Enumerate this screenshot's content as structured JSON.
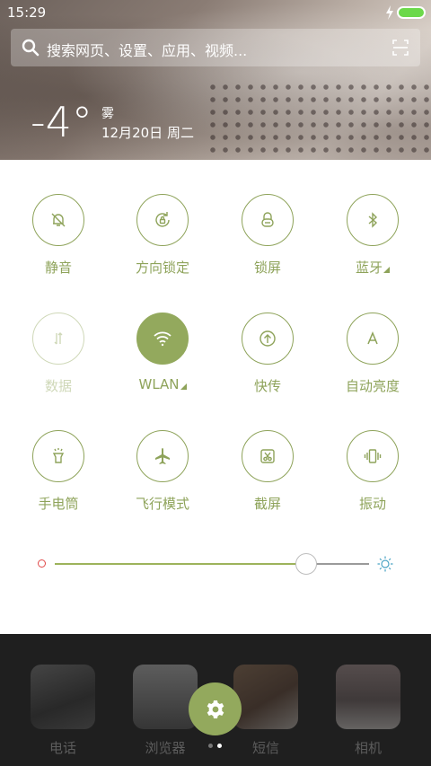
{
  "status_bar": {
    "time": "15:29",
    "battery_color": "#6cd94a"
  },
  "search": {
    "placeholder": "搜索网页、设置、应用、视频..."
  },
  "weather": {
    "temperature": "-4°",
    "condition": "雾",
    "date": "12月20日 周二"
  },
  "accent_color": "#93a95d",
  "toggles": [
    {
      "label": "静音",
      "icon": "bell-off-icon",
      "state": "off"
    },
    {
      "label": "方向锁定",
      "icon": "rotation-lock-icon",
      "state": "off"
    },
    {
      "label": "锁屏",
      "icon": "lock-icon",
      "state": "off"
    },
    {
      "label": "蓝牙",
      "icon": "bluetooth-icon",
      "state": "off",
      "has_menu": true
    },
    {
      "label": "数据",
      "icon": "mobile-data-icon",
      "state": "disabled"
    },
    {
      "label": "WLAN",
      "icon": "wifi-icon",
      "state": "on",
      "has_menu": true
    },
    {
      "label": "快传",
      "icon": "quick-transfer-icon",
      "state": "off"
    },
    {
      "label": "自动亮度",
      "icon": "auto-brightness-icon",
      "state": "off"
    },
    {
      "label": "手电筒",
      "icon": "flashlight-icon",
      "state": "off"
    },
    {
      "label": "飞行模式",
      "icon": "airplane-icon",
      "state": "off"
    },
    {
      "label": "截屏",
      "icon": "screenshot-icon",
      "state": "off"
    },
    {
      "label": "振动",
      "icon": "vibrate-icon",
      "state": "off"
    }
  ],
  "brightness": {
    "level": 0.8
  },
  "dock": {
    "apps": [
      {
        "label": "电话",
        "icon": "phone-app-icon"
      },
      {
        "label": "浏览器",
        "icon": "browser-app-icon"
      },
      {
        "label": "短信",
        "icon": "messages-app-icon"
      },
      {
        "label": "相机",
        "icon": "camera-app-icon"
      }
    ],
    "settings_icon": "gear-icon",
    "pages": 2,
    "current_page": 2
  }
}
